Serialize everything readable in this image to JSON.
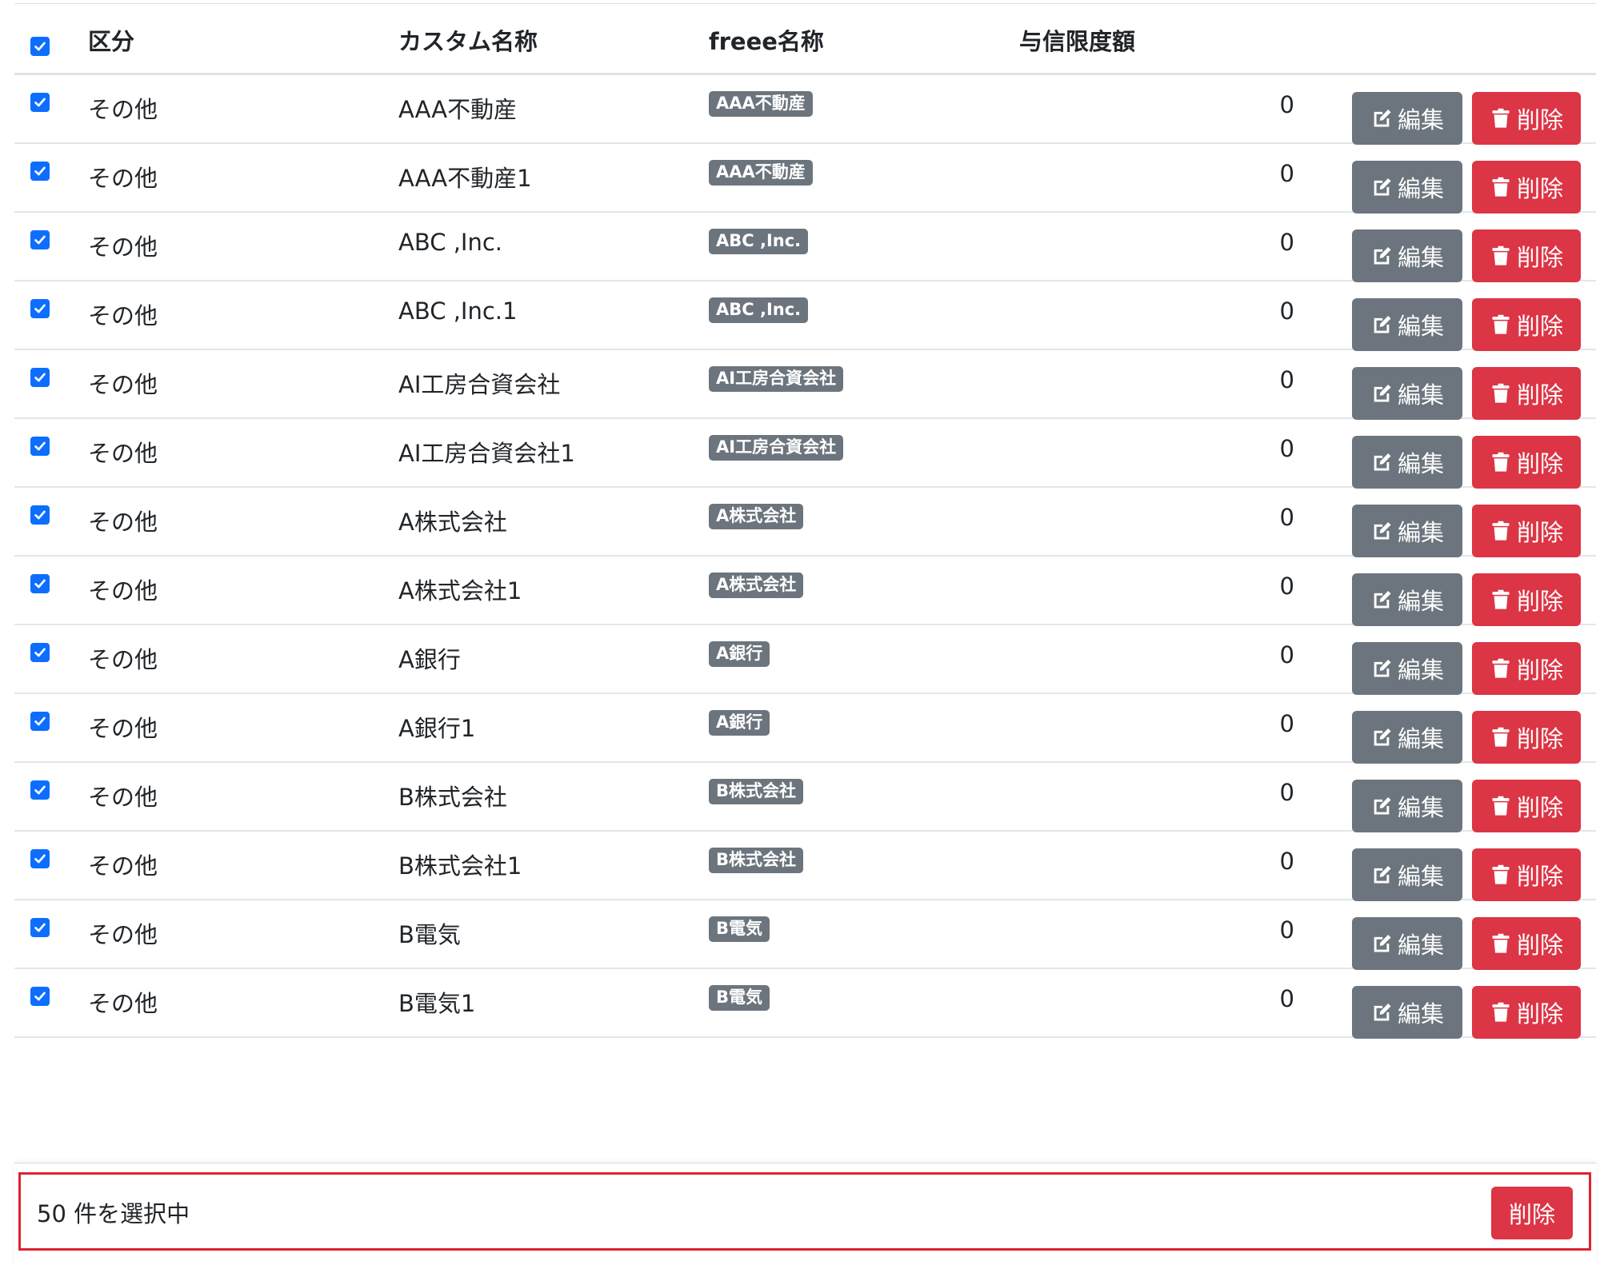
{
  "header": {
    "col_category": "区分",
    "col_custom_name": "カスタム名称",
    "col_freee_name": "freee名称",
    "col_credit_limit": "与信限度額"
  },
  "actions": {
    "edit_label": "編集",
    "delete_label": "削除"
  },
  "rows": [
    {
      "category": "その他",
      "custom_name": "AAA不動産",
      "freee_name": "AAA不動産",
      "credit_limit": "0",
      "checked": true
    },
    {
      "category": "その他",
      "custom_name": "AAA不動産1",
      "freee_name": "AAA不動産",
      "credit_limit": "0",
      "checked": true
    },
    {
      "category": "その他",
      "custom_name": "ABC ,Inc.",
      "freee_name": "ABC ,Inc.",
      "credit_limit": "0",
      "checked": true
    },
    {
      "category": "その他",
      "custom_name": "ABC ,Inc.1",
      "freee_name": "ABC ,Inc.",
      "credit_limit": "0",
      "checked": true
    },
    {
      "category": "その他",
      "custom_name": "AI工房合資会社",
      "freee_name": "AI工房合資会社",
      "credit_limit": "0",
      "checked": true
    },
    {
      "category": "その他",
      "custom_name": "AI工房合資会社1",
      "freee_name": "AI工房合資会社",
      "credit_limit": "0",
      "checked": true
    },
    {
      "category": "その他",
      "custom_name": "A株式会社",
      "freee_name": "A株式会社",
      "credit_limit": "0",
      "checked": true
    },
    {
      "category": "その他",
      "custom_name": "A株式会社1",
      "freee_name": "A株式会社",
      "credit_limit": "0",
      "checked": true
    },
    {
      "category": "その他",
      "custom_name": "A銀行",
      "freee_name": "A銀行",
      "credit_limit": "0",
      "checked": true
    },
    {
      "category": "その他",
      "custom_name": "A銀行1",
      "freee_name": "A銀行",
      "credit_limit": "0",
      "checked": true
    },
    {
      "category": "その他",
      "custom_name": "B株式会社",
      "freee_name": "B株式会社",
      "credit_limit": "0",
      "checked": true
    },
    {
      "category": "その他",
      "custom_name": "B株式会社1",
      "freee_name": "B株式会社",
      "credit_limit": "0",
      "checked": true
    },
    {
      "category": "その他",
      "custom_name": "B電気",
      "freee_name": "B電気",
      "credit_limit": "0",
      "checked": true
    },
    {
      "category": "その他",
      "custom_name": "B電気1",
      "freee_name": "B電気",
      "credit_limit": "0",
      "checked": true
    }
  ],
  "bulk_bar": {
    "selected_text": "50 件を選択中",
    "delete_label": "削除"
  },
  "colors": {
    "primary": "#0d6efd",
    "secondary": "#6c757d",
    "danger": "#dc3545",
    "highlight_outline": "#e0212f"
  },
  "icons": {
    "edit": "edit-icon",
    "delete": "trash-icon",
    "check": "check-icon"
  }
}
